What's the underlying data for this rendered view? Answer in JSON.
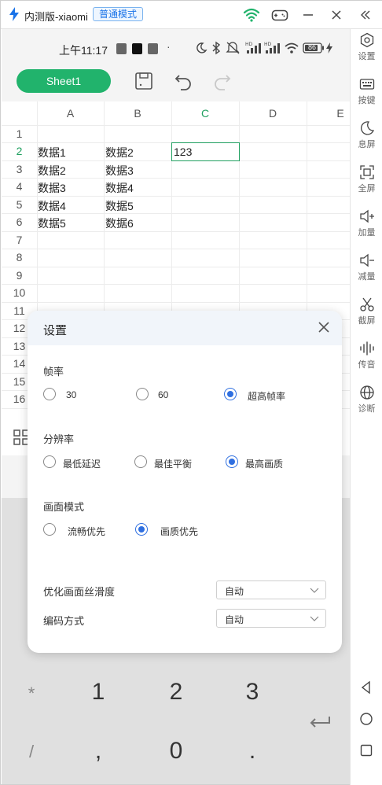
{
  "window": {
    "title": "内测版-xiaomi",
    "mode_badge": "普通模式"
  },
  "status_bar": {
    "time": "上午11:17",
    "battery": "86"
  },
  "toolbar": {
    "sheet_tab": "Sheet1"
  },
  "grid": {
    "columns": [
      "A",
      "B",
      "C",
      "D",
      "E"
    ],
    "rows": [
      "1",
      "2",
      "3",
      "4",
      "5",
      "6",
      "7",
      "8",
      "9",
      "10",
      "11",
      "12",
      "13",
      "14",
      "15",
      "16"
    ],
    "cells": {
      "a2": "数据1",
      "b2": "数据2",
      "c2": "123",
      "a3": "数据2",
      "b3": "数据3",
      "a4": "数据3",
      "b4": "数据4",
      "a5": "数据4",
      "b5": "数据5",
      "a6": "数据5",
      "b6": "数据6"
    },
    "selected_cell": "C2"
  },
  "dialog": {
    "title": "设置",
    "frame_rate": {
      "label": "帧率",
      "options": [
        "30",
        "60",
        "超高帧率"
      ],
      "selected": "超高帧率"
    },
    "resolution": {
      "label": "分辨率",
      "options": [
        "最低延迟",
        "最佳平衡",
        "最高画质"
      ],
      "selected": "最高画质"
    },
    "picture_mode": {
      "label": "画面模式",
      "options": [
        "流畅优先",
        "画质优先"
      ],
      "selected": "画质优先"
    },
    "smoothness": {
      "label": "优化画面丝滑度",
      "value": "自动"
    },
    "encoding": {
      "label": "编码方式",
      "value": "自动"
    }
  },
  "keyboard": {
    "row1": [
      "*",
      "1",
      "2",
      "3"
    ],
    "row2": [
      "/",
      ",",
      "0",
      "."
    ]
  },
  "sidebar": {
    "items": [
      {
        "label": "设置",
        "icon": "settings-icon"
      },
      {
        "label": "按键",
        "icon": "keyboard-icon"
      },
      {
        "label": "息屏",
        "icon": "moon-icon"
      },
      {
        "label": "全屏",
        "icon": "fullscreen-icon"
      },
      {
        "label": "加量",
        "icon": "volume-up-icon"
      },
      {
        "label": "减量",
        "icon": "volume-down-icon"
      },
      {
        "label": "截屏",
        "icon": "scissors-icon"
      },
      {
        "label": "传音",
        "icon": "audio-icon"
      },
      {
        "label": "诊断",
        "icon": "globe-icon"
      }
    ]
  },
  "colors": {
    "accent_green": "#21b36c",
    "radio_blue": "#2f6fe0",
    "badge_blue": "#1a73e8"
  }
}
